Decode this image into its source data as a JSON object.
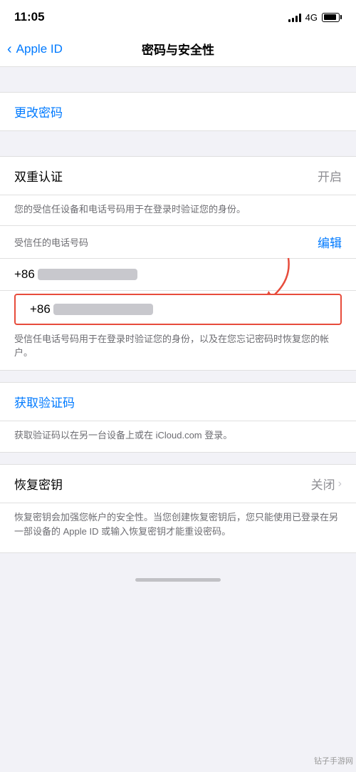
{
  "statusBar": {
    "time": "11:05",
    "network": "4G"
  },
  "navBar": {
    "backLabel": "Apple ID",
    "title": "密码与安全性"
  },
  "changePassword": {
    "label": "更改密码"
  },
  "twoFactor": {
    "title": "双重认证",
    "status": "开启",
    "description": "您的受信任设备和电话号码用于在登录时验证您的身份。",
    "trustedPhoneLabel": "受信任的电话号码",
    "editLabel": "编辑",
    "phone1Prefix": "+86",
    "phone2Prefix": "+86",
    "phoneNote": "受信任电话号码用于在登录时验证您的身份，以及在您忘记密码时恢复您的帐户。"
  },
  "verificationCode": {
    "linkLabel": "获取验证码",
    "description": "获取验证码以在另一台设备上或在 iCloud.com 登录。"
  },
  "recoveryKey": {
    "title": "恢复密钥",
    "status": "关闭",
    "description": "恢复密钥会加强您帐户的安全性。当您创建恢复密钥后，您只能使用已登录在另一部设备的 Apple ID 或输入恢复密钥才能重设密码。"
  },
  "watermark": "钻子手游网"
}
